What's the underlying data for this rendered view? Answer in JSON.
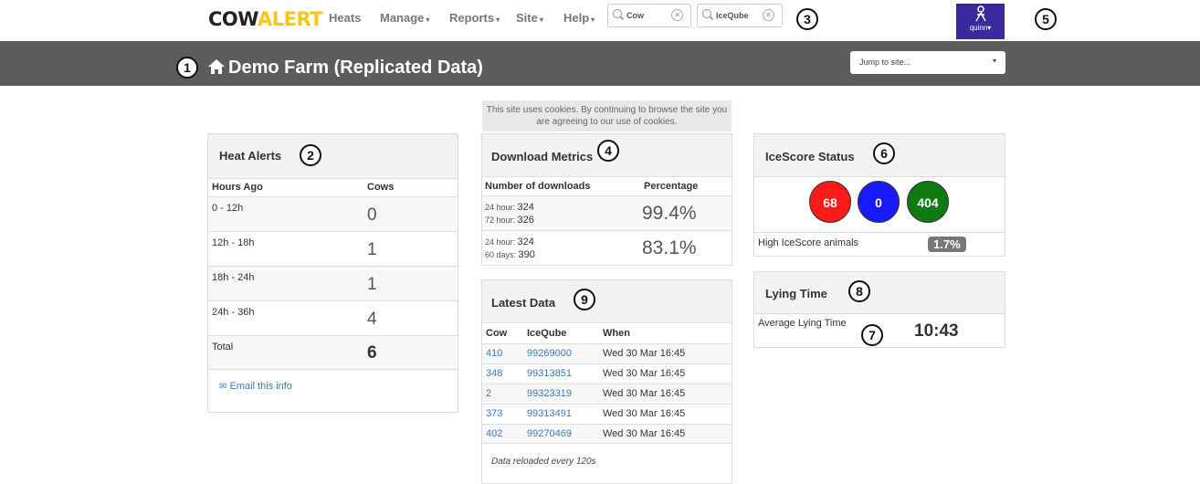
{
  "nav": {
    "logo_part1": "COW",
    "logo_part2": "ALERT",
    "heats": "Heats",
    "manage": "Manage",
    "reports": "Reports",
    "site": "Site",
    "help": "Help",
    "search_cow": "Cow",
    "search_iceqube": "IceQube",
    "user": "quinn",
    "icons": [
      "search-icon",
      "clear-icon",
      "user-icon",
      "caret-down-icon"
    ]
  },
  "header": {
    "title": "Demo Farm (Replicated Data)",
    "jump_placeholder": "Jump to site...",
    "home_icon": "home-icon"
  },
  "cookie_notice": "This site uses cookies. By continuing to browse the site you are agreeing to our use of cookies.",
  "heat_alerts": {
    "title": "Heat Alerts",
    "col_hours": "Hours Ago",
    "col_cows": "Cows",
    "rows": [
      {
        "label": "0 - 12h",
        "value": "0"
      },
      {
        "label": "12h - 18h",
        "value": "1"
      },
      {
        "label": "18h - 24h",
        "value": "1"
      },
      {
        "label": "24h - 36h",
        "value": "4"
      }
    ],
    "total_label": "Total",
    "total_value": "6",
    "email_link": "Email this info"
  },
  "download_metrics": {
    "title": "Download Metrics",
    "col_downloads": "Number of downloads",
    "col_percentage": "Percentage",
    "rows": [
      {
        "l1_label": "24 hour:",
        "l1_value": "324",
        "l2_label": "72 hour:",
        "l2_value": "326",
        "pct": "99.4%"
      },
      {
        "l1_label": "24 hour:",
        "l1_value": "324",
        "l2_label": "60 days:",
        "l2_value": "390",
        "pct": "83.1%"
      }
    ]
  },
  "latest_data": {
    "title": "Latest Data",
    "col_cow": "Cow",
    "col_iceqube": "IceQube",
    "col_when": "When",
    "rows": [
      {
        "cow": "410",
        "iceqube": "99269000",
        "when": "Wed 30 Mar 16:45"
      },
      {
        "cow": "348",
        "iceqube": "99313851",
        "when": "Wed 30 Mar 16:45"
      },
      {
        "cow": "2",
        "iceqube": "99323319",
        "when": "Wed 30 Mar 16:45"
      },
      {
        "cow": "373",
        "iceqube": "99313491",
        "when": "Wed 30 Mar 16:45"
      },
      {
        "cow": "402",
        "iceqube": "99270469",
        "when": "Wed 30 Mar 16:45"
      }
    ],
    "footer": "Data reloaded every 120s"
  },
  "icescore": {
    "title": "IceScore Status",
    "circles": [
      {
        "value": "68",
        "color": "#ff1a1a"
      },
      {
        "value": "0",
        "color": "#1a1aff"
      },
      {
        "value": "404",
        "color": "#0f7a0f"
      }
    ],
    "high_label": "High IceScore animals",
    "high_value": "1.7%"
  },
  "lying_time": {
    "title": "Lying Time",
    "label": "Average Lying Time",
    "value": "10:43"
  },
  "markers": [
    "1",
    "2",
    "3",
    "4",
    "5",
    "6",
    "7",
    "8",
    "9"
  ]
}
